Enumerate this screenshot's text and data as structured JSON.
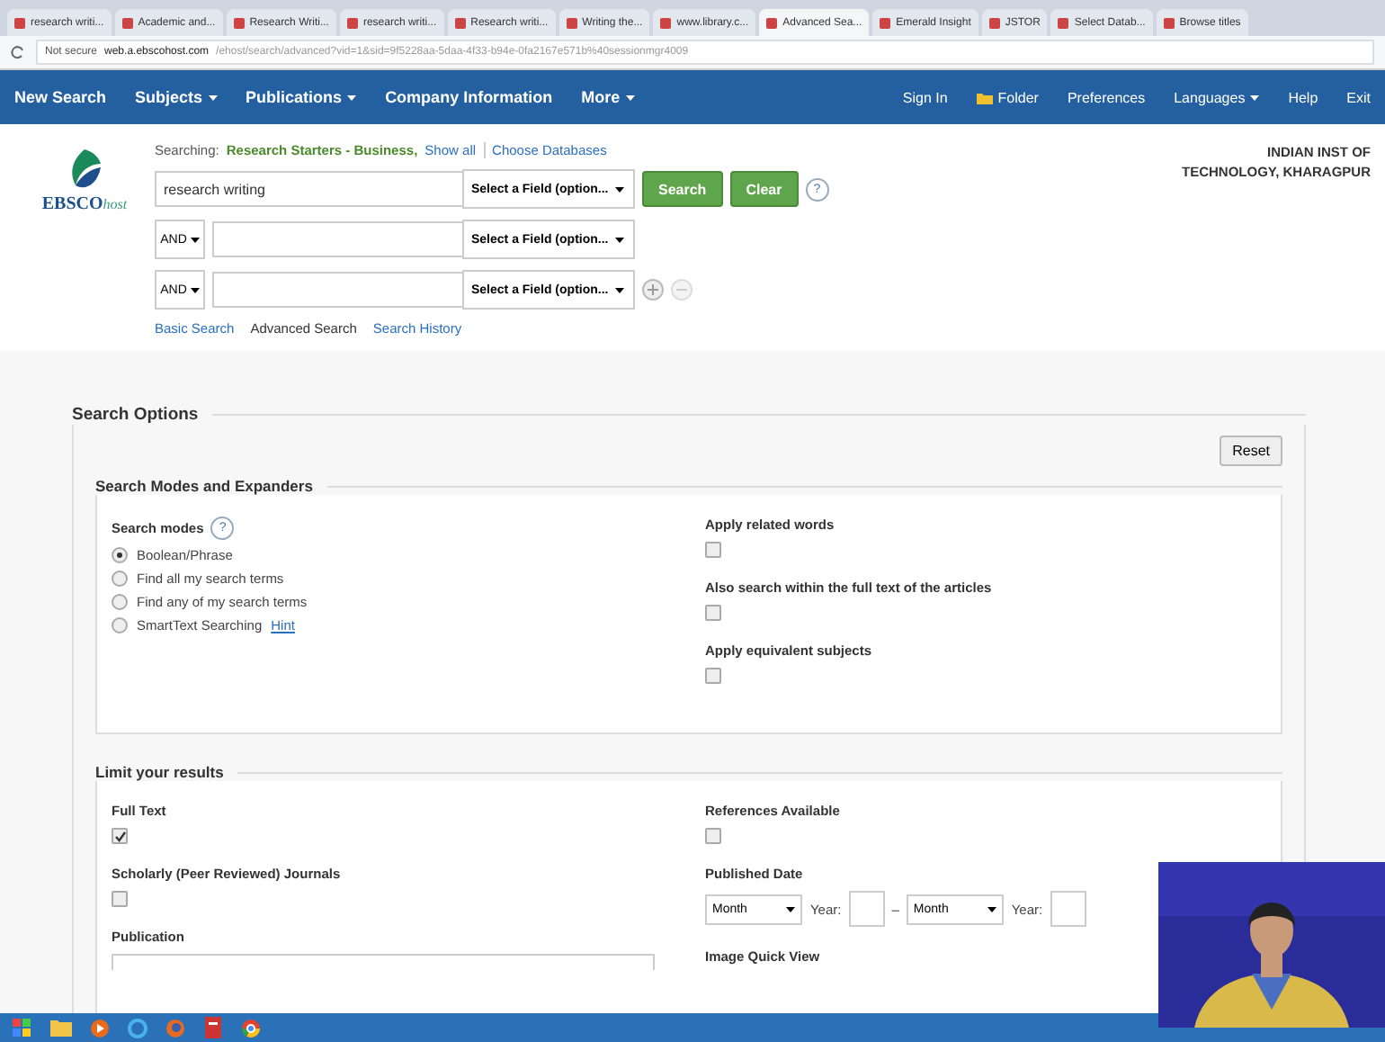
{
  "browser": {
    "tabs": [
      {
        "title": "research writi...",
        "selected": false
      },
      {
        "title": "Academic and...",
        "selected": false
      },
      {
        "title": "Research Writi...",
        "selected": false
      },
      {
        "title": "research writi...",
        "selected": false
      },
      {
        "title": "Research writi...",
        "selected": false
      },
      {
        "title": "Writing the...",
        "selected": false
      },
      {
        "title": "www.library.c...",
        "selected": false
      },
      {
        "title": "Advanced Sea...",
        "selected": true
      },
      {
        "title": "Emerald Insight",
        "selected": false
      },
      {
        "title": "JSTOR",
        "selected": false
      },
      {
        "title": "Select Datab...",
        "selected": false
      },
      {
        "title": "Browse titles",
        "selected": false
      }
    ],
    "address": {
      "security": "Not secure",
      "host": "web.a.ebscohost.com",
      "path": "/ehost/search/advanced?vid=1&sid=9f5228aa-5daa-4f33-b94e-0fa2167e571b%40sessionmgr4009"
    }
  },
  "nav": {
    "left": [
      {
        "label": "New Search",
        "dropdown": false
      },
      {
        "label": "Subjects",
        "dropdown": true
      },
      {
        "label": "Publications",
        "dropdown": true
      },
      {
        "label": "Company Information",
        "dropdown": false
      },
      {
        "label": "More",
        "dropdown": true
      }
    ],
    "right": [
      {
        "label": "Sign In",
        "dropdown": false,
        "kind": "link"
      },
      {
        "label": "Folder",
        "dropdown": false,
        "kind": "folder"
      },
      {
        "label": "Preferences",
        "dropdown": false,
        "kind": "link"
      },
      {
        "label": "Languages",
        "dropdown": true,
        "kind": "link"
      },
      {
        "label": "Help",
        "dropdown": false,
        "kind": "link"
      },
      {
        "label": "Exit",
        "dropdown": false,
        "kind": "link"
      }
    ]
  },
  "header": {
    "logo": {
      "main": "EBSCO",
      "tail": "host"
    },
    "searching": "Searching:",
    "database": "Research Starters - Business,",
    "show_all": "Show all",
    "choose": "Choose Databases",
    "institution": [
      "INDIAN INST OF",
      "TECHNOLOGY, KHARAGPUR"
    ]
  },
  "search_rows": [
    {
      "operator": null,
      "value": "research writing",
      "field": "Select a Field (option..."
    },
    {
      "operator": "AND",
      "value": "",
      "field": "Select a Field (option..."
    },
    {
      "operator": "AND",
      "value": "",
      "field": "Select a Field (option..."
    }
  ],
  "buttons": {
    "search": "Search",
    "clear": "Clear",
    "help": "?"
  },
  "links": [
    {
      "label": "Basic Search",
      "selected": false
    },
    {
      "label": "Advanced Search",
      "selected": true
    },
    {
      "label": "Search History",
      "selected": false
    }
  ],
  "search_options": {
    "title": "Search Options",
    "reset": "Reset",
    "modes_section": {
      "title": "Search Modes and Expanders",
      "modes_label": "Search modes",
      "help": "?",
      "modes": [
        {
          "label": "Boolean/Phrase",
          "selected": true
        },
        {
          "label": "Find all my search terms",
          "selected": false
        },
        {
          "label": "Find any of my search terms",
          "selected": false
        },
        {
          "label": "SmartText Searching",
          "selected": false
        }
      ],
      "hint": "Hint",
      "expanders": [
        {
          "label": "Apply related words",
          "checked": false
        },
        {
          "label": "Also search within the full text of the articles",
          "checked": false
        },
        {
          "label": "Apply equivalent subjects",
          "checked": false
        }
      ]
    },
    "limit_section": {
      "title": "Limit your results",
      "left": [
        {
          "kind": "checkbox",
          "label": "Full Text",
          "checked": true
        },
        {
          "kind": "checkbox",
          "label": "Scholarly (Peer Reviewed) Journals",
          "checked": false
        },
        {
          "kind": "field",
          "label": "Publication"
        }
      ],
      "right": [
        {
          "kind": "checkbox",
          "label": "References Available",
          "checked": false
        },
        {
          "kind": "date",
          "label": "Published Date",
          "range": [
            {
              "month": "Month",
              "year": "Year:"
            },
            {
              "month": "Month",
              "year": "Year:"
            }
          ],
          "dash": "–"
        },
        {
          "kind": "label",
          "label": "Image Quick View"
        }
      ]
    }
  }
}
